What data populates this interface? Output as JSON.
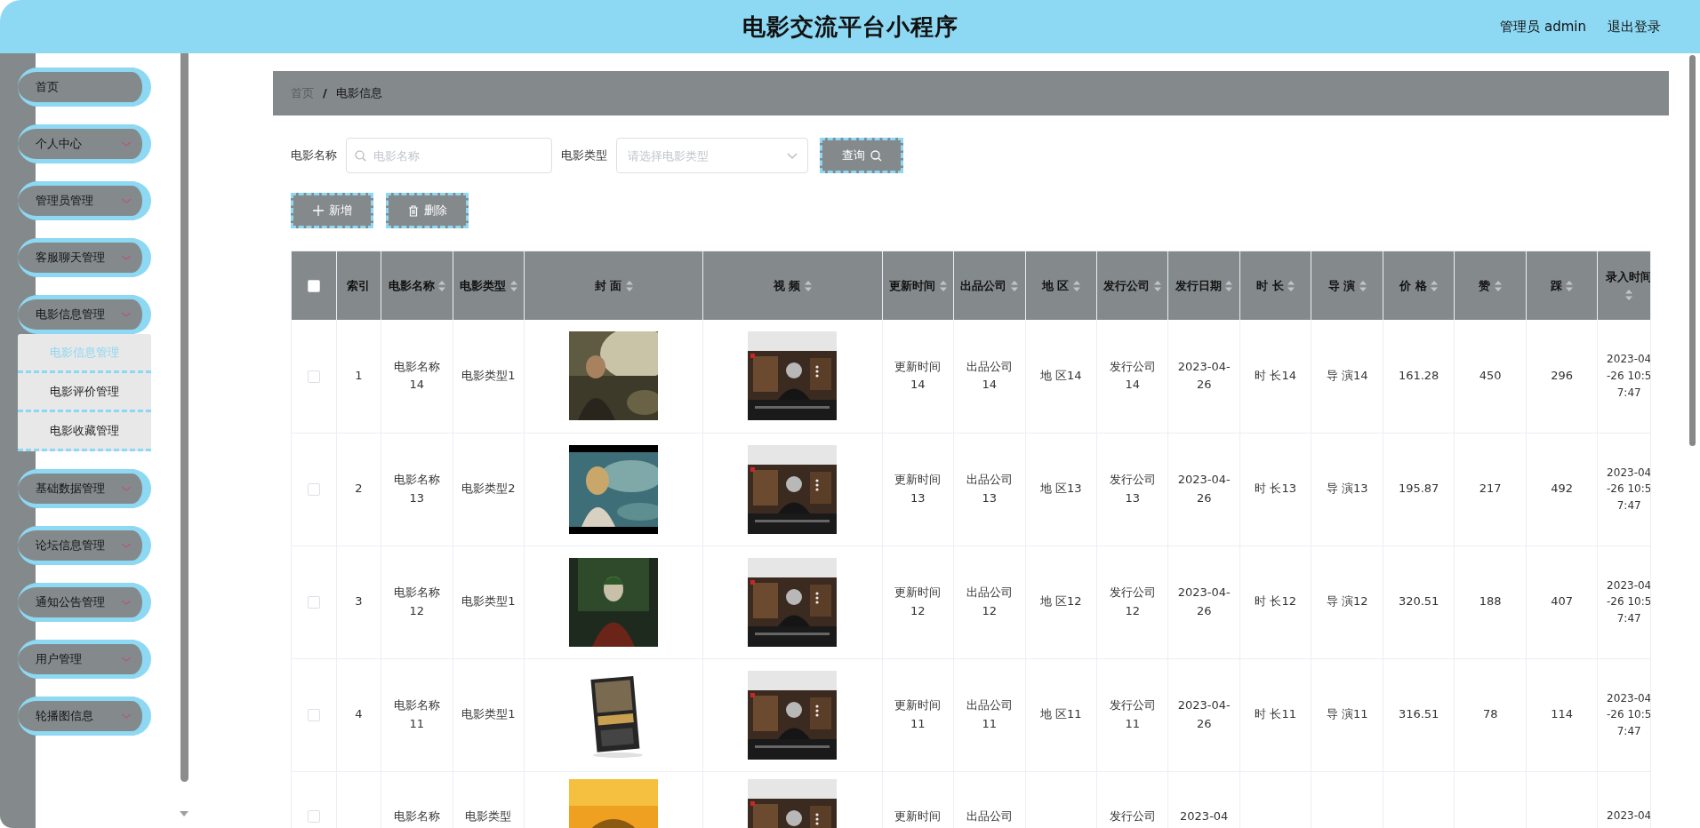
{
  "header": {
    "title": "电影交流平台小程序",
    "user": "管理员 admin",
    "logout": "退出登录"
  },
  "sidebar": {
    "items": [
      {
        "label": "首页",
        "kind": "link"
      },
      {
        "label": "个人中心",
        "kind": "menu"
      },
      {
        "label": "管理员管理",
        "kind": "menu"
      },
      {
        "label": "客服聊天管理",
        "kind": "menu"
      },
      {
        "label": "电影信息管理",
        "kind": "menu",
        "children": [
          {
            "label": "电影信息管理",
            "selected": true
          },
          {
            "label": "电影评价管理",
            "selected": false
          },
          {
            "label": "电影收藏管理",
            "selected": false
          }
        ]
      },
      {
        "label": "基础数据管理",
        "kind": "menu"
      },
      {
        "label": "论坛信息管理",
        "kind": "menu"
      },
      {
        "label": "通知公告管理",
        "kind": "menu"
      },
      {
        "label": "用户管理",
        "kind": "menu"
      },
      {
        "label": "轮播图信息",
        "kind": "menu"
      }
    ]
  },
  "breadcrumb": {
    "items": [
      "首页",
      "电影信息"
    ],
    "separator": "/"
  },
  "search": {
    "fields": [
      {
        "label": "电影名称",
        "kind": "text",
        "placeholder": "电影名称"
      },
      {
        "label": "电影类型",
        "kind": "select",
        "placeholder": "请选择电影类型"
      }
    ],
    "button": "查询"
  },
  "actions": [
    {
      "label": "新增",
      "kind": "add"
    },
    {
      "label": "删除",
      "kind": "delete"
    }
  ],
  "table": {
    "select_all": {
      "checked": false
    },
    "columns": [
      {
        "label": "索引",
        "sortable": false,
        "kind": "text"
      },
      {
        "label": "电影名称",
        "sortable": true,
        "kind": "text"
      },
      {
        "label": "电影类型",
        "sortable": true,
        "kind": "text"
      },
      {
        "label": "封 面",
        "sortable": true,
        "kind": "cover"
      },
      {
        "label": "视 频",
        "sortable": true,
        "kind": "video"
      },
      {
        "label": "更新时间",
        "sortable": true,
        "kind": "text"
      },
      {
        "label": "出品公司",
        "sortable": true,
        "kind": "text"
      },
      {
        "label": "地 区",
        "sortable": true,
        "kind": "text"
      },
      {
        "label": "发行公司",
        "sortable": true,
        "kind": "text"
      },
      {
        "label": "发行日期",
        "sortable": true,
        "kind": "text"
      },
      {
        "label": "时 长",
        "sortable": true,
        "kind": "text"
      },
      {
        "label": "导 演",
        "sortable": true,
        "kind": "text"
      },
      {
        "label": "价 格",
        "sortable": true,
        "kind": "text"
      },
      {
        "label": "赞",
        "sortable": true,
        "kind": "text"
      },
      {
        "label": "踩",
        "sortable": true,
        "kind": "text"
      },
      {
        "label": "录入时间",
        "sortable": true,
        "kind": "text"
      }
    ],
    "rows": [
      {
        "checked": false,
        "clipped": false,
        "cells": [
          "1",
          "电影名称14",
          "电影类型1",
          {
            "kind": "picture"
          },
          {
            "kind": "picture"
          },
          "更新时间14",
          "出品公司14",
          "地 区14",
          "发行公司14",
          "2023-04-26",
          "时 长14",
          "导 演14",
          "161.28",
          "450",
          "296",
          "2023-04-26 10:57:47"
        ]
      },
      {
        "checked": false,
        "clipped": false,
        "cells": [
          "2",
          "电影名称13",
          "电影类型2",
          {
            "kind": "picture"
          },
          {
            "kind": "picture"
          },
          "更新时间13",
          "出品公司13",
          "地 区13",
          "发行公司13",
          "2023-04-26",
          "时 长13",
          "导 演13",
          "195.87",
          "217",
          "492",
          "2023-04-26 10:57:47"
        ]
      },
      {
        "checked": false,
        "clipped": false,
        "cells": [
          "3",
          "电影名称12",
          "电影类型1",
          {
            "kind": "picture"
          },
          {
            "kind": "picture"
          },
          "更新时间12",
          "出品公司12",
          "地 区12",
          "发行公司12",
          "2023-04-26",
          "时 长12",
          "导 演12",
          "320.51",
          "188",
          "407",
          "2023-04-26 10:57:47"
        ]
      },
      {
        "checked": false,
        "clipped": false,
        "cells": [
          "4",
          "电影名称11",
          "电影类型1",
          {
            "kind": "picture"
          },
          {
            "kind": "picture"
          },
          "更新时间11",
          "出品公司11",
          "地 区11",
          "发行公司11",
          "2023-04-26",
          "时 长11",
          "导 演11",
          "316.51",
          "78",
          "114",
          "2023-04-26 10:57:47"
        ]
      },
      {
        "checked": false,
        "clipped": true,
        "cells": [
          null,
          "电影名称",
          "电影类型",
          {
            "kind": "picture"
          },
          {
            "kind": "picture"
          },
          "更新时间",
          "出品公司",
          null,
          "发行公司",
          "2023-04",
          null,
          null,
          null,
          null,
          null,
          "2023-04"
        ]
      }
    ]
  }
}
